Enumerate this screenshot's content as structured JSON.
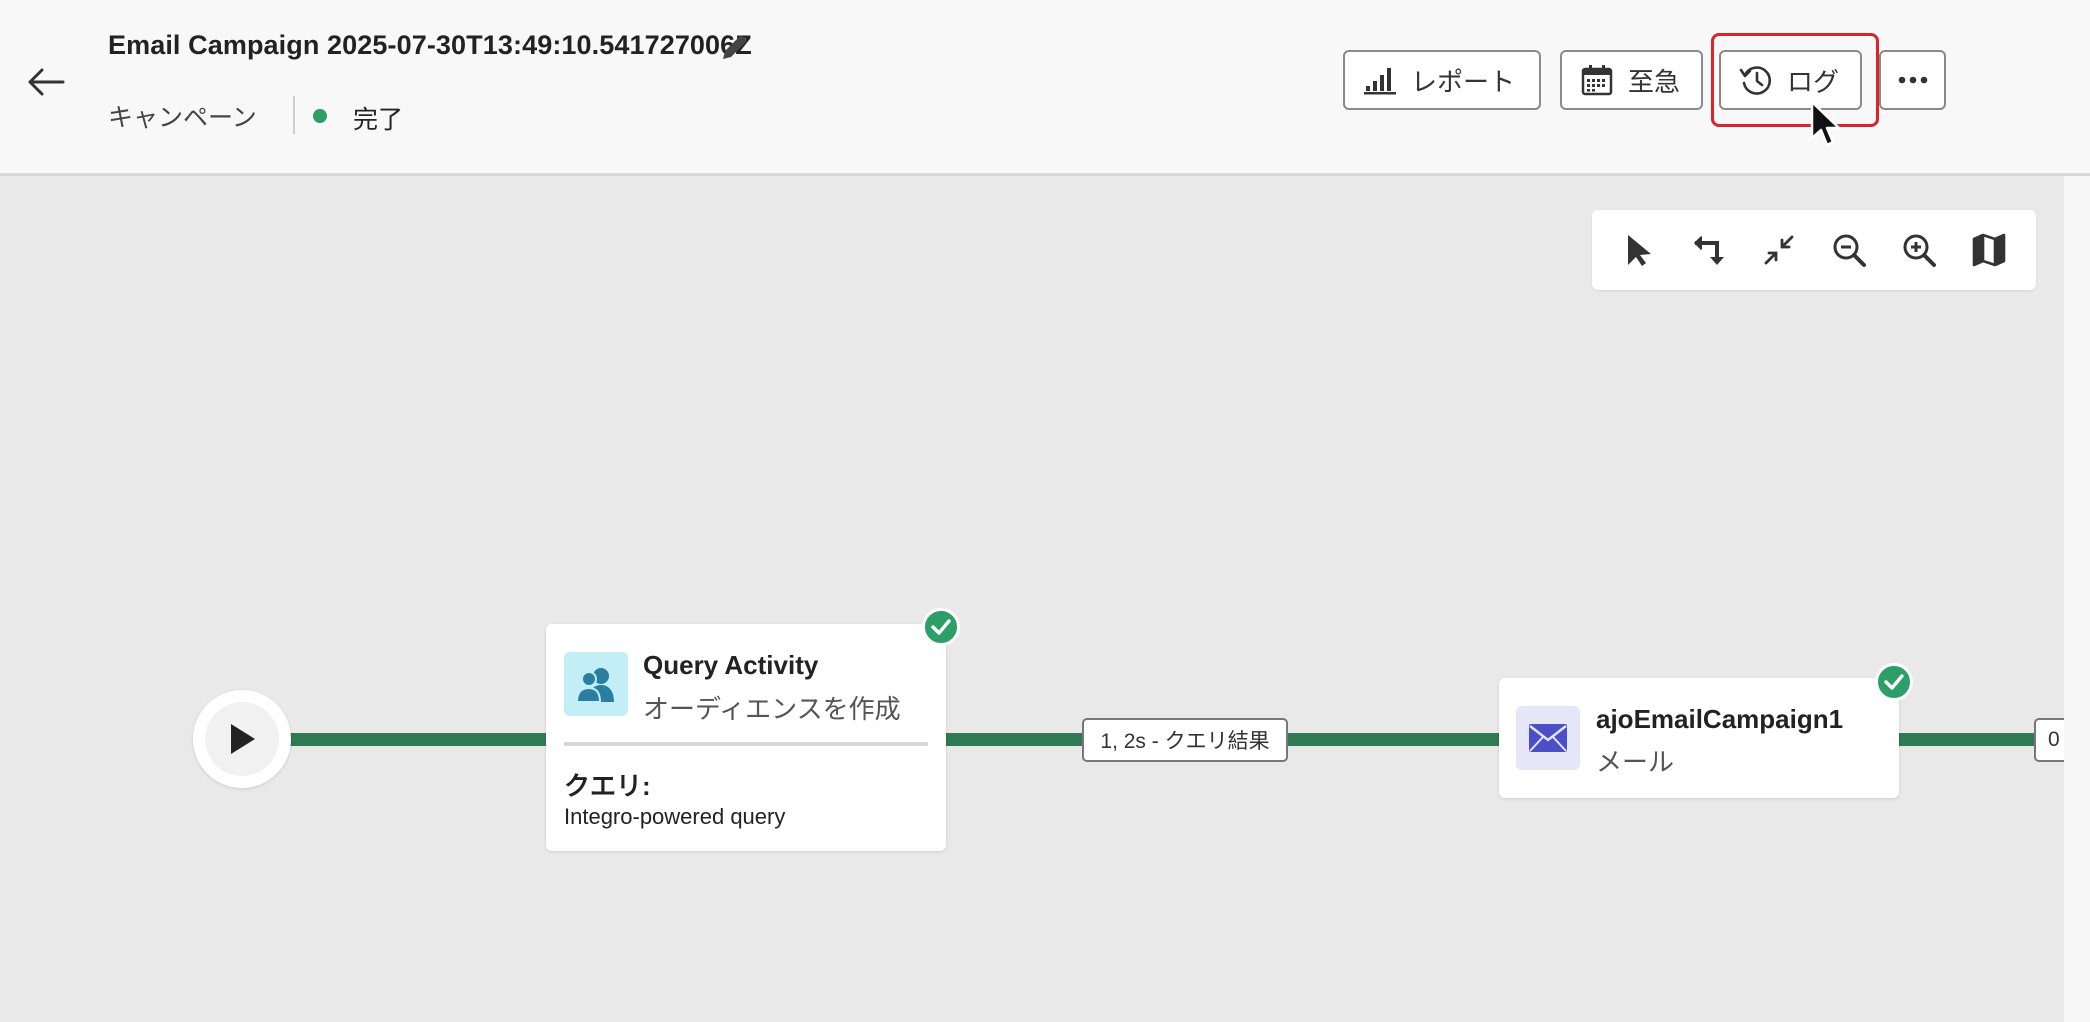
{
  "header": {
    "title": "Email Campaign 2025-07-30T13:49:10.541727006Z",
    "type_label": "キャンペーン",
    "status_label": "完了",
    "status_color": "#2e9e69"
  },
  "actions": {
    "report_label": "レポート",
    "schedule_label": "至急",
    "logs_label": "ログ",
    "more_icon": "more-icon"
  },
  "canvas_toolbar": {
    "tools": [
      "select-icon",
      "reorder-icon",
      "collapse-icon",
      "zoom-out-icon",
      "zoom-in-icon",
      "map-icon"
    ]
  },
  "workflow": {
    "query_node": {
      "title": "Query Activity",
      "subtitle": "オーディエンスを作成",
      "query_label": "クエリ:",
      "query_value": "Integro-powered query",
      "status": "complete"
    },
    "edge1_label": "1, 2s - クエリ結果",
    "email_node": {
      "title": "ajoEmailCampaign1",
      "subtitle": "メール",
      "status": "complete"
    },
    "edge2_label": "0"
  },
  "colors": {
    "link": "#2f7a52",
    "highlight": "#d8262a",
    "query_icon_bg": "#c4eef7",
    "email_icon_bg": "#e6e6f9"
  }
}
